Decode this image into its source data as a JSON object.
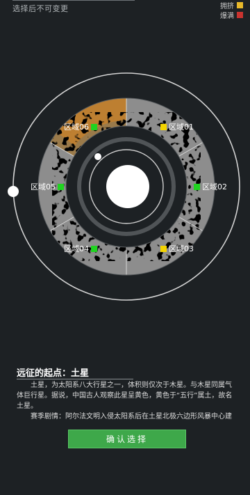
{
  "header": {
    "hint": "选择后不可变更"
  },
  "legend": [
    {
      "label": "拥挤",
      "color": "#e8b82a"
    },
    {
      "label": "爆满",
      "color": "#c8332f"
    }
  ],
  "map": {
    "zones": [
      {
        "id": "01",
        "label": "区域01",
        "status_color": "#f4d400"
      },
      {
        "id": "02",
        "label": "区域02",
        "status_color": "#20d420"
      },
      {
        "id": "03",
        "label": "区域03",
        "status_color": "#f4d400"
      },
      {
        "id": "04",
        "label": "区域04",
        "status_color": "#20d420"
      },
      {
        "id": "05",
        "label": "区域05",
        "status_color": "#20d420"
      },
      {
        "id": "06",
        "label": "区域06",
        "status_color": "#20d420"
      }
    ],
    "selected_zone": "06",
    "selected_color": "#c8822a"
  },
  "panel": {
    "title": "远征的起点：土星",
    "para1": "土星，为太阳系八大行星之一，体积则仅次于木星。与木星同属气体巨行星。据说，中国古人观察此星呈黄色，黄色于“五行”属土，故名土星。",
    "para2": "赛季剧情：阿尔法文明入侵太阳系后在土星北极六边形风暴中心建立了跳跃据点，并且在土星的“瑶亚”和“泰坦”两颗卫星分别建立了若干要塞，占领入侵者所有要塞和据点是本次行动的最终目标。在小行"
  },
  "confirm_label": "确认选择"
}
